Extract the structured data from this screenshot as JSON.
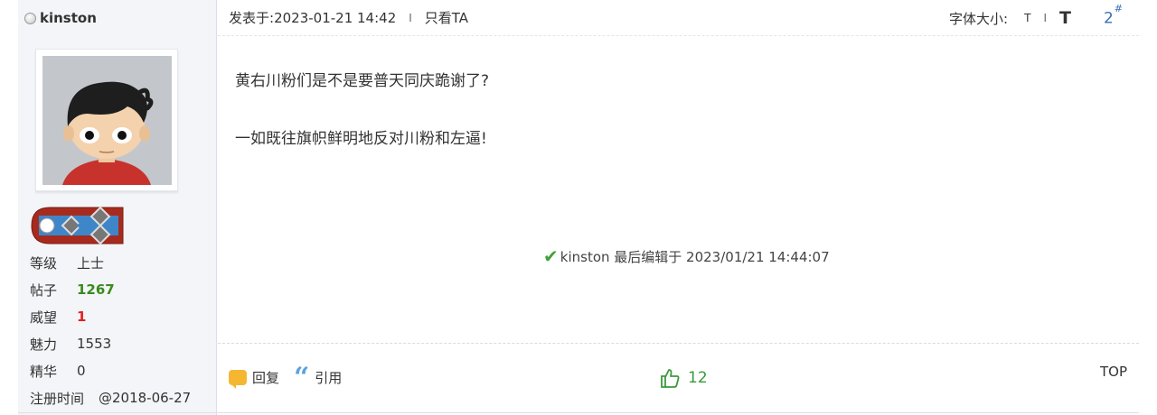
{
  "author": {
    "username": "kinston",
    "stats": [
      {
        "label": "等级",
        "value": "上士",
        "tone": "normal"
      },
      {
        "label": "帖子",
        "value": "1267",
        "tone": "green"
      },
      {
        "label": "威望",
        "value": "1",
        "tone": "red"
      },
      {
        "label": "魅力",
        "value": "1553",
        "tone": "normal"
      },
      {
        "label": "精华",
        "value": "0",
        "tone": "normal"
      }
    ],
    "register_label": "注册时间",
    "register_value": "@2018-06-27"
  },
  "header": {
    "posted_prefix": "发表于:",
    "posted_time": "2023-01-21 14:42",
    "separator": "I",
    "view_author_only": "只看TA",
    "font_size_label": "字体大小:",
    "font_small": "T",
    "font_sep": "I",
    "font_large": "T",
    "floor_number": "2",
    "floor_mark": "#"
  },
  "content": {
    "paragraphs": [
      "黄右川粉们是不是要普天同庆跪谢了?",
      "一如既往旗帜鲜明地反对川粉和左逼!"
    ],
    "edit_note": "kinston 最后编辑于 2023/01/21 14:44:07"
  },
  "footer": {
    "reply_label": "回复",
    "quote_label": "引用",
    "like_count": "12",
    "top_label": "TOP"
  },
  "colors": {
    "accent_blue": "#3a6fb5",
    "green": "#3a8a1e",
    "red": "#e02020",
    "sidebar_bg": "#f3f5f8"
  },
  "icons": [
    "status-dot-icon",
    "check-icon",
    "reply-icon",
    "quote-icon",
    "thumbs-up-icon",
    "rank-badge-icon"
  ]
}
